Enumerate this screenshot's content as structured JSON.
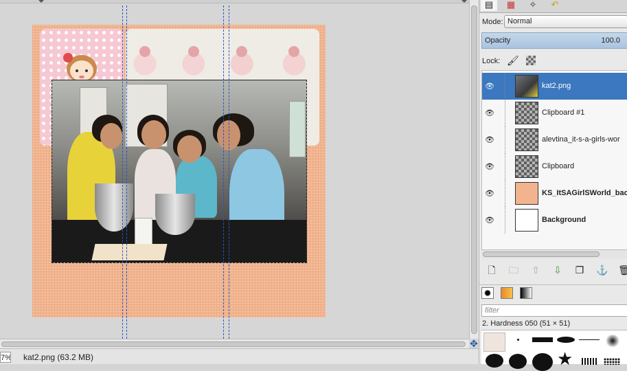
{
  "statusbar": {
    "zoom": "7%",
    "text": "kat2.png (63.2 MB)"
  },
  "dock": {
    "tab_icons": [
      "layers-icon",
      "channels-icon",
      "paths-icon",
      "undo-history-icon"
    ],
    "mode_label": "Mode:",
    "mode_value": "Normal",
    "opacity_label": "Opacity",
    "opacity_value": "100.0",
    "lock_label": "Lock:",
    "layers": [
      {
        "name": "kat2.png",
        "selected": true
      },
      {
        "name": "Clipboard #1",
        "selected": false
      },
      {
        "name": "alevtina_it-s-a-girls-wor",
        "selected": false
      },
      {
        "name": "Clipboard",
        "selected": false
      },
      {
        "name": "KS_ItSAGirlSWorld_backg",
        "selected": false
      },
      {
        "name": "Background",
        "selected": false
      }
    ],
    "layer_tools": [
      "new-layer-icon",
      "new-group-icon",
      "raise-layer-icon",
      "lower-layer-icon",
      "duplicate-layer-icon",
      "anchor-icon",
      "delete-layer-icon"
    ],
    "filter_placeholder": "filter",
    "brush_name": "2. Hardness 050 (51 × 51)"
  },
  "colors": {
    "selection": "#3b78bf",
    "guide": "#2457c5",
    "background_paper": "#f2b48e"
  }
}
